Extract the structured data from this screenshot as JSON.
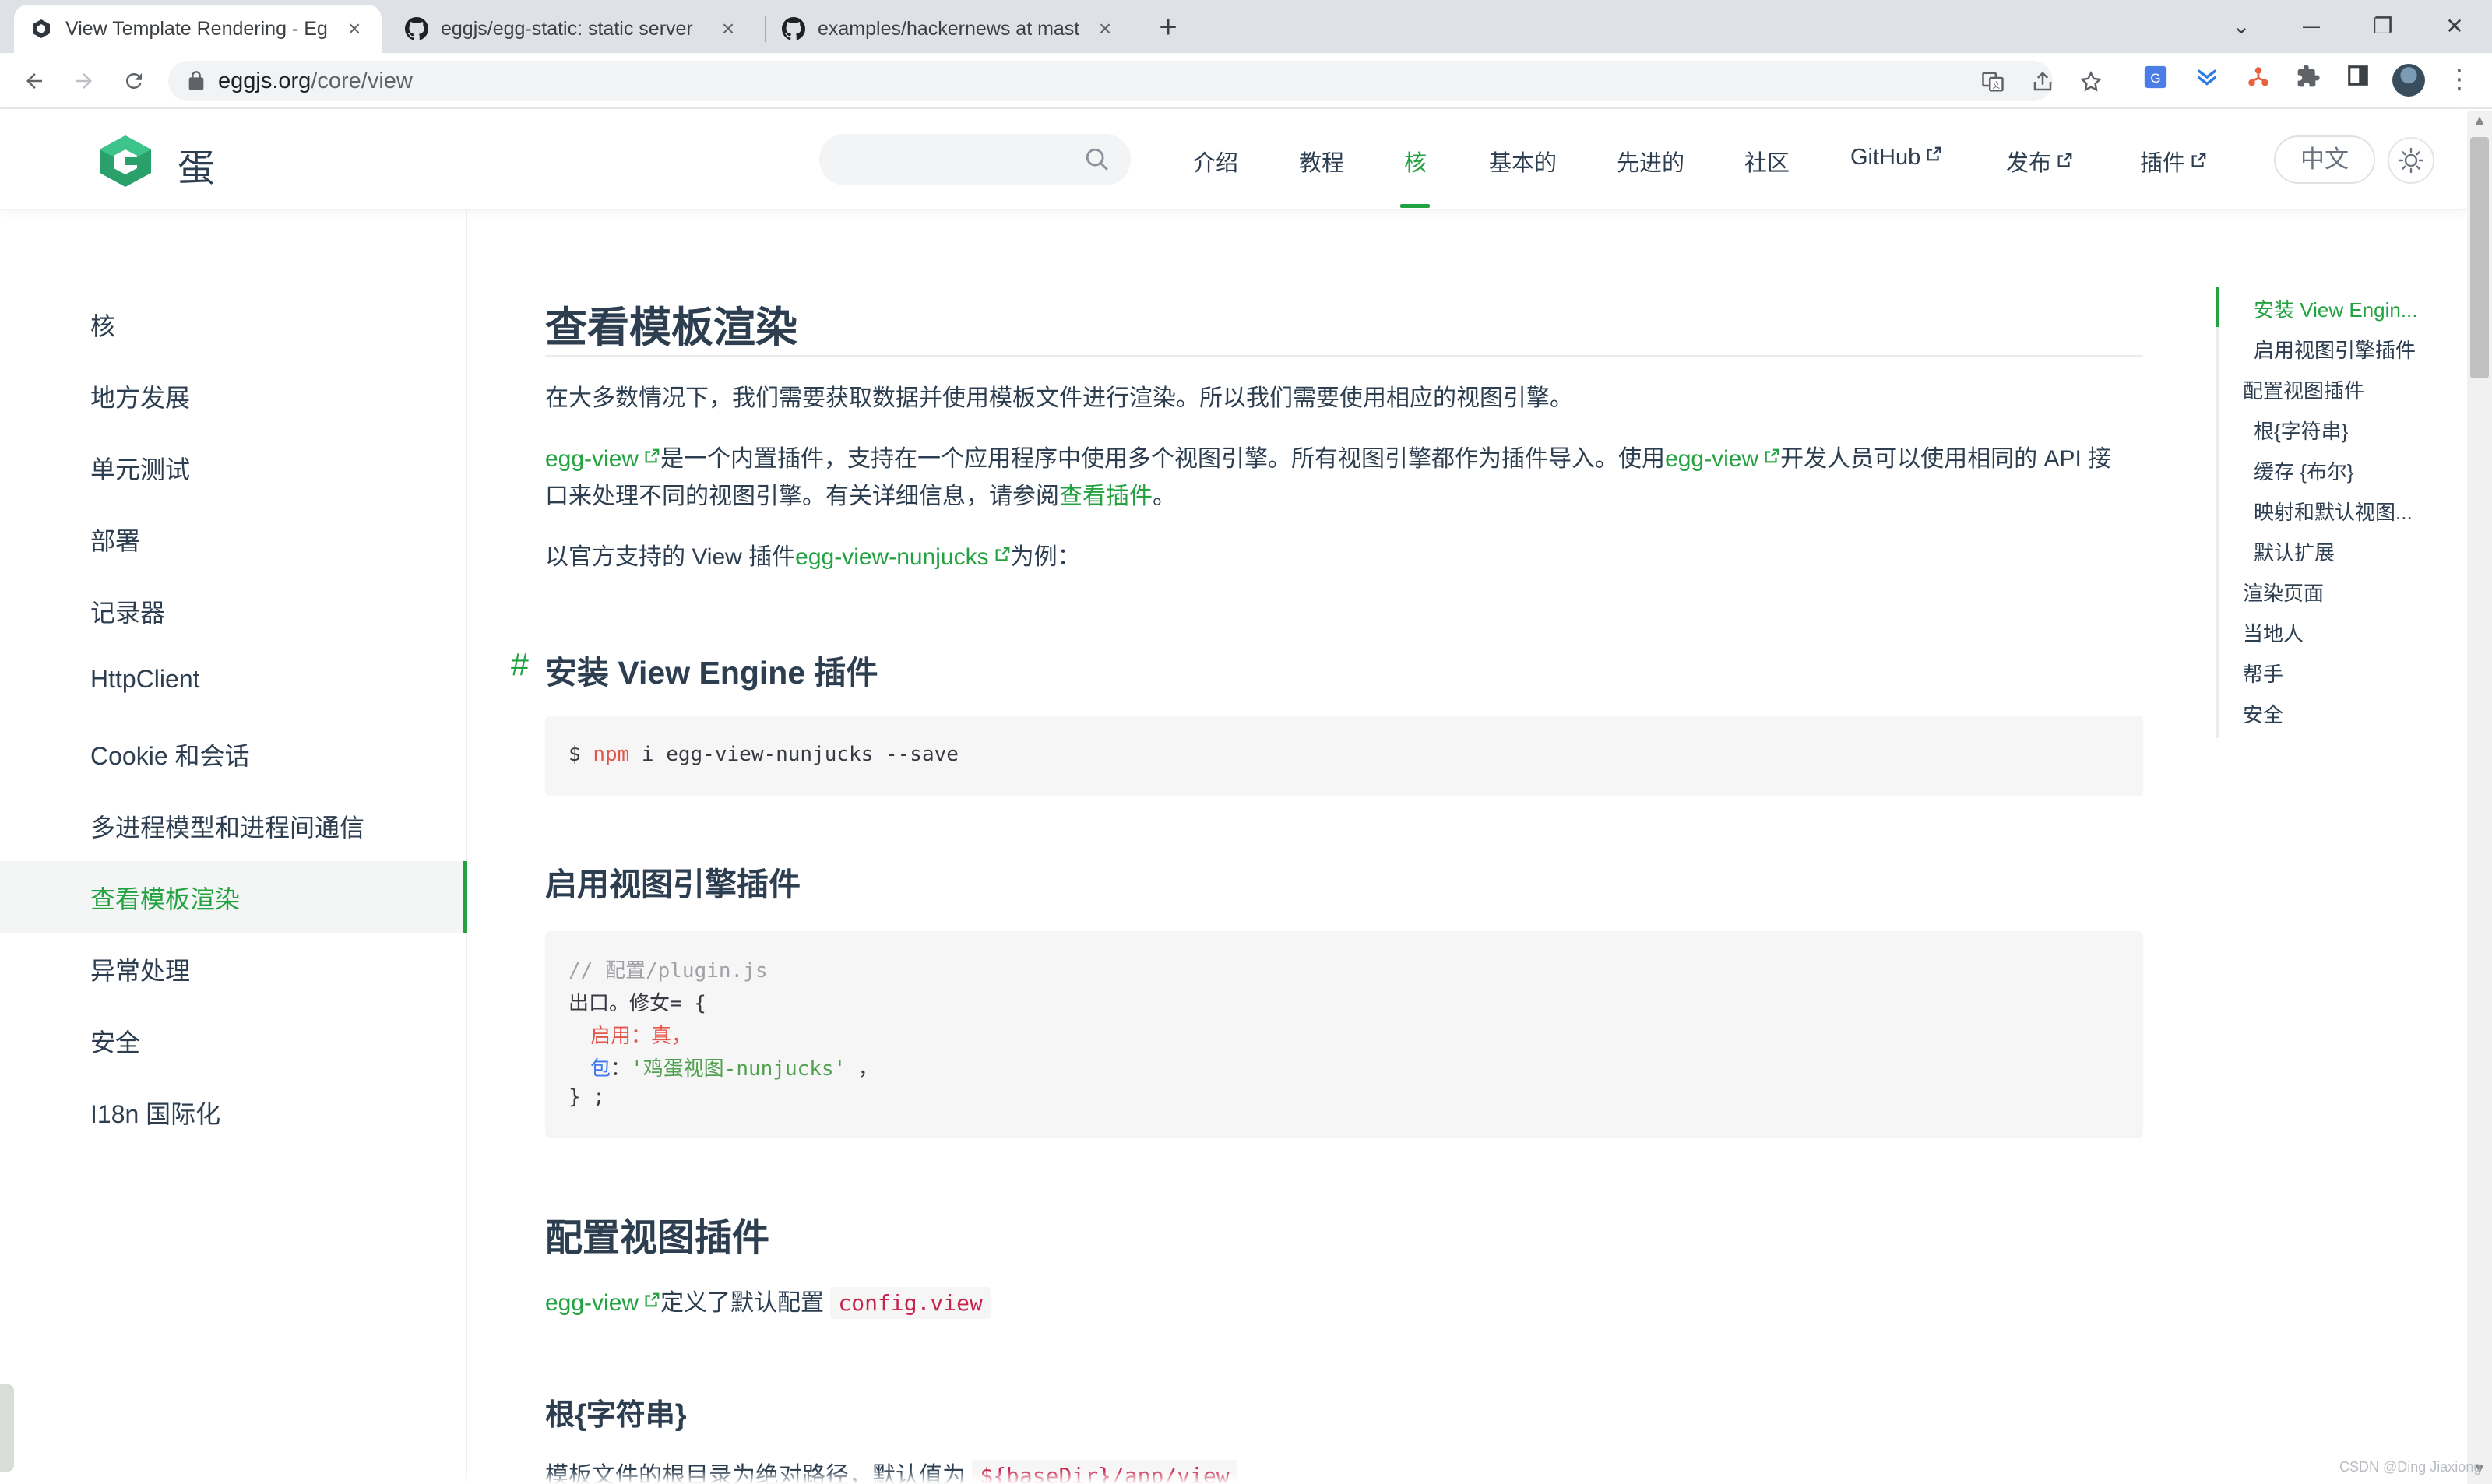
{
  "browser": {
    "tabs": [
      {
        "title": "View Template Rendering - Eg",
        "icon": "eggjs-logo-icon"
      },
      {
        "title": "eggjs/egg-static: static server",
        "icon": "github-icon"
      },
      {
        "title": "examples/hackernews at mast",
        "icon": "github-icon"
      }
    ],
    "url_domain": "eggjs.org",
    "url_path": "/core/view",
    "window_controls": {
      "dropdown": "⌄",
      "minimize": "—",
      "maximize": "❐",
      "close": "✕"
    }
  },
  "site": {
    "brand": "蛋",
    "search_placeholder": "",
    "nav": [
      {
        "label": "介绍",
        "external": false
      },
      {
        "label": "教程",
        "external": false
      },
      {
        "label": "核",
        "external": false,
        "active": true
      },
      {
        "label": "基本的",
        "external": false
      },
      {
        "label": "先进的",
        "external": false
      },
      {
        "label": "社区",
        "external": false
      },
      {
        "label": "GitHub",
        "external": true
      },
      {
        "label": "发布",
        "external": true
      },
      {
        "label": "插件",
        "external": true
      }
    ],
    "lang_button": "中文",
    "accent_color": "#22a240"
  },
  "sidebar": {
    "items": [
      {
        "label": "核"
      },
      {
        "label": "地方发展"
      },
      {
        "label": "单元测试"
      },
      {
        "label": "部署"
      },
      {
        "label": "记录器"
      },
      {
        "label": "HttpClient"
      },
      {
        "label": "Cookie 和会话"
      },
      {
        "label": "多进程模型和进程间通信"
      },
      {
        "label": "查看模板渲染",
        "active": true
      },
      {
        "label": "异常处理"
      },
      {
        "label": "安全"
      },
      {
        "label": "I18n 国际化"
      }
    ]
  },
  "content": {
    "title": "查看模板渲染",
    "intro": "在大多数情况下，我们需要获取数据并使用模板文件进行渲染。所以我们需要使用相应的视图引擎。",
    "p2": {
      "link1": "egg-view",
      "text1": "是一个内置插件，支持在一个应用程序中使用多个视图引擎。所有视图引擎都作为插件导入。使用",
      "link2": "egg-view",
      "text2": "开发人员可以使用相同的 API 接",
      "line2": "口来处理不同的视图引擎。有关详细信息，请参阅",
      "link3": "查看插件",
      "end": "。"
    },
    "p3": {
      "pre": "以官方支持的 View 插件",
      "link": "egg-view-nunjucks",
      "post": "为例："
    },
    "section1": {
      "hash": "#",
      "title": "安装 View Engine 插件",
      "code": {
        "prompt": "$ ",
        "cmd": "npm",
        "rest": " i egg-view-nunjucks --save"
      }
    },
    "section2": {
      "title": "启用视图引擎插件",
      "code": {
        "comment": "// 配置/plugin.js",
        "l2": "出口。修女= {",
        "l3_key": "启用",
        "l3_val": "：真，",
        "l4_key": "包",
        "l4_sep": "：",
        "l4_val": "'鸡蛋视图-nunjucks'",
        "l4_end": " ，",
        "l5": "} ;"
      }
    },
    "section3": {
      "title": "配置视图插件",
      "link": "egg-view",
      "text": "定义了默认配置",
      "code": "config.view"
    },
    "section4": {
      "title": "根{字符串}",
      "text": "模板文件的根目录为绝对路径，默认值为",
      "code": "${baseDir}/app/view"
    }
  },
  "toc": {
    "items": [
      {
        "label": "安装 View Engin...",
        "active": true,
        "level": 2
      },
      {
        "label": "启用视图引擎插件",
        "level": 2
      },
      {
        "label": "配置视图插件",
        "level": 1
      },
      {
        "label": "根{字符串}",
        "level": 2
      },
      {
        "label": "缓存 {布尔}",
        "level": 2
      },
      {
        "label": "映射和默认视图...",
        "level": 2
      },
      {
        "label": "默认扩展",
        "level": 2
      },
      {
        "label": "渲染页面",
        "level": 1
      },
      {
        "label": "当地人",
        "level": 1
      },
      {
        "label": "帮手",
        "level": 1
      },
      {
        "label": "安全",
        "level": 1
      }
    ]
  },
  "watermark": "CSDN @Ding Jiaxiong"
}
